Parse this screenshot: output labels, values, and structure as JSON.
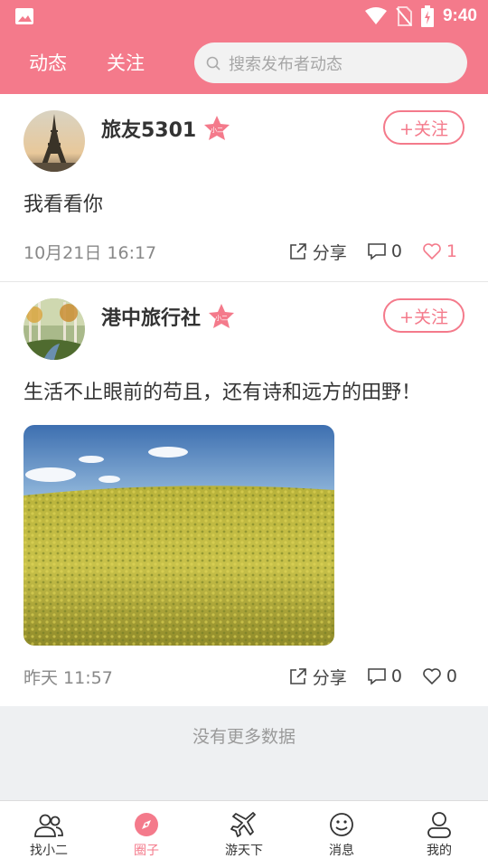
{
  "status_bar": {
    "time": "9:40"
  },
  "header": {
    "tabs": [
      {
        "label": "动态"
      },
      {
        "label": "关注"
      }
    ],
    "search_placeholder": "搜索发布者动态"
  },
  "colors": {
    "accent": "#f47a8b",
    "background": "#eef0f2"
  },
  "posts": [
    {
      "author": "旅友5301",
      "badge_text": "小二",
      "follow_label": "+关注",
      "text": "我看看你",
      "time": "10月21日 16:17",
      "share_label": "分享",
      "comments": "0",
      "likes": "1",
      "liked": true
    },
    {
      "author": "港中旅行社",
      "badge_text": "小二",
      "follow_label": "+关注",
      "text": "生活不止眼前的苟且，还有诗和远方的田野！",
      "time": "昨天 11:57",
      "share_label": "分享",
      "comments": "0",
      "likes": "0",
      "liked": false
    }
  ],
  "no_more_text": "没有更多数据",
  "tabbar": {
    "items": [
      {
        "label": "找小二",
        "icon": "people-icon"
      },
      {
        "label": "圈子",
        "icon": "compass-icon",
        "active": true
      },
      {
        "label": "游天下",
        "icon": "airplane-icon"
      },
      {
        "label": "消息",
        "icon": "smiley-icon"
      },
      {
        "label": "我的",
        "icon": "user-icon"
      }
    ]
  }
}
